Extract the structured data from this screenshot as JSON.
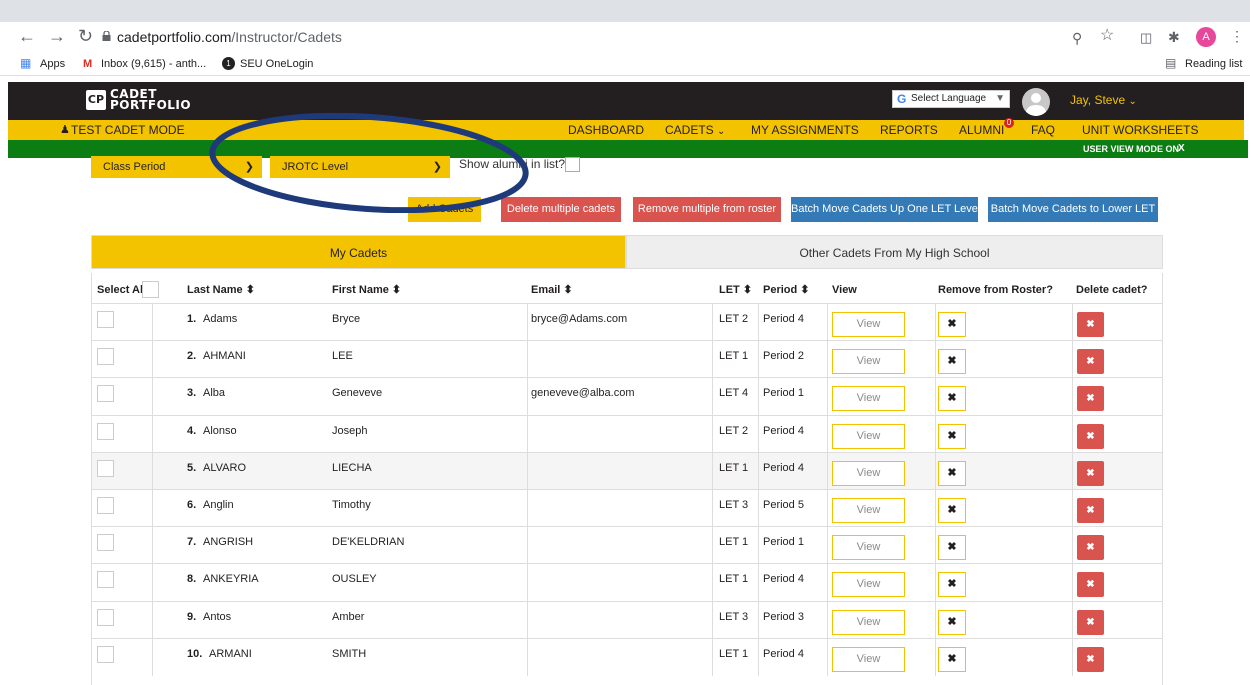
{
  "browser": {
    "url_host": "cadetportfolio.com",
    "url_path": "/Instructor/Cadets",
    "profile_initial": "A",
    "bookmarks": {
      "apps": "Apps",
      "inbox": "Inbox (9,615) - anth...",
      "seu": "SEU OneLogin",
      "reading_list": "Reading list"
    }
  },
  "header": {
    "logo_mark": "CP",
    "logo_line1": "CADET",
    "logo_line2": "PORTFOLIO",
    "translate_label": "Select Language",
    "user_name": "Jay, Steve"
  },
  "nav": {
    "test_mode": "TEST CADET MODE",
    "items": [
      "DASHBOARD",
      "CADETS",
      "MY ASSIGNMENTS",
      "REPORTS",
      "ALUMNI",
      "FAQ",
      "UNIT WORKSHEETS"
    ],
    "alumni_badge": "0",
    "view_mode": "USER VIEW MODE ON",
    "view_mode_close": "X"
  },
  "filters": {
    "class_period": "Class Period",
    "jrotc_level": "JROTC Level",
    "show_alumni": "Show alumni in list?"
  },
  "actions": {
    "add_cadets": "Add Cadets",
    "delete_multiple": "Delete multiple cadets",
    "remove_multiple": "Remove multiple from roster",
    "batch_up": "Batch Move Cadets Up One LET Level",
    "batch_down": "Batch Move Cadets to Lower LET"
  },
  "tabs": {
    "mine": "My Cadets",
    "other": "Other Cadets From My High School"
  },
  "table": {
    "headers": {
      "select_all": "Select All",
      "last_name": "Last Name ⬍",
      "first_name": "First Name ⬍",
      "email": "Email ⬍",
      "let": "LET ⬍",
      "period": "Period ⬍",
      "view": "View",
      "remove": "Remove from Roster?",
      "delete": "Delete cadet?"
    },
    "view_label": "View",
    "remove_label": "✖",
    "delete_label": "✖",
    "rows": [
      {
        "num": "1.",
        "last": "Adams",
        "first": "Bryce",
        "email": "bryce@Adams.com",
        "let": "LET 2",
        "period": "Period 4"
      },
      {
        "num": "2.",
        "last": "AHMANI",
        "first": "LEE",
        "email": "",
        "let": "LET 1",
        "period": "Period 2"
      },
      {
        "num": "3.",
        "last": "Alba",
        "first": "Geneveve",
        "email": "geneveve@alba.com",
        "let": "LET 4",
        "period": "Period 1"
      },
      {
        "num": "4.",
        "last": "Alonso",
        "first": "Joseph",
        "email": "",
        "let": "LET 2",
        "period": "Period 4"
      },
      {
        "num": "5.",
        "last": "ALVARO",
        "first": "LIECHA",
        "email": "",
        "let": "LET 1",
        "period": "Period 4"
      },
      {
        "num": "6.",
        "last": "Anglin",
        "first": "Timothy",
        "email": "",
        "let": "LET 3",
        "period": "Period 5"
      },
      {
        "num": "7.",
        "last": "ANGRISH",
        "first": "DE'KELDRIAN",
        "email": "",
        "let": "LET 1",
        "period": "Period 1"
      },
      {
        "num": "8.",
        "last": "ANKEYRIA",
        "first": "OUSLEY",
        "email": "",
        "let": "LET 1",
        "period": "Period 4"
      },
      {
        "num": "9.",
        "last": "Antos",
        "first": "Amber",
        "email": "",
        "let": "LET 3",
        "period": "Period 3"
      },
      {
        "num": "10.",
        "last": "ARMANI",
        "first": "SMITH",
        "email": "",
        "let": "LET 1",
        "period": "Period 4"
      }
    ]
  },
  "colors": {
    "brand_yellow": "#f3c300",
    "brand_dark": "#231f20",
    "view_mode_green": "#0c7d13",
    "danger_red": "#d9534f",
    "primary_blue": "#337ab7",
    "annotation_ellipse": "#1f3a7a"
  }
}
